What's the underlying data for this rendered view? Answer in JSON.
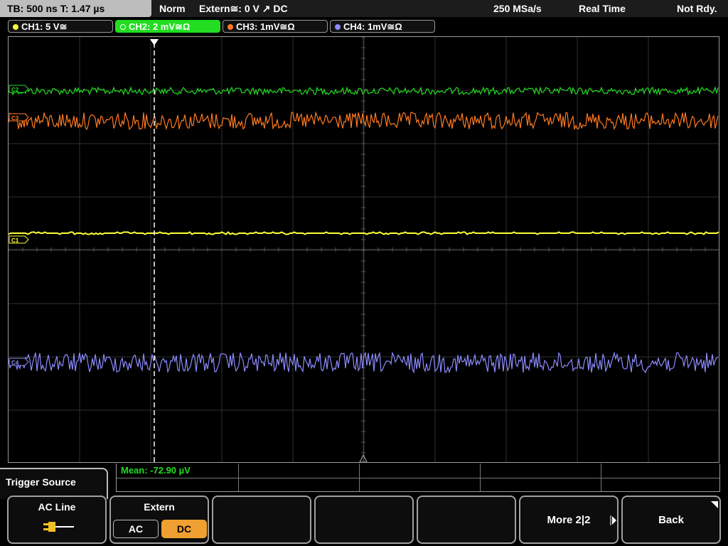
{
  "status": {
    "timebase": "TB: 500 ns   T: 1.47 µs",
    "trigger_mode": "Norm",
    "trigger_source_info": "Extern≅: 0 V ↗ DC",
    "sample_rate": "250 MSa/s",
    "acquisition": "Real Time",
    "state": "Not Rdy."
  },
  "channels": [
    {
      "label": "CH1: 5 V≅",
      "color": "#ffff33"
    },
    {
      "label": "CH2: 2 mV≅Ω",
      "color": "#22dd22"
    },
    {
      "label": "CH3: 1mV≅Ω",
      "color": "#ff7a20"
    },
    {
      "label": "CH4: 1mV≅Ω",
      "color": "#8c8cff"
    }
  ],
  "markers": {
    "ch2": "C2",
    "ch3": "C3",
    "ch1": "C1",
    "ch4": "C4"
  },
  "measurement": {
    "mean": "Mean: -72.90 µV"
  },
  "softkeys": {
    "panel_title": "Trigger Source",
    "ac_line": "AC Line",
    "extern": "Extern",
    "extern_ac": "AC",
    "extern_dc": "DC",
    "more": "More 2|2",
    "back": "Back"
  },
  "colors": {
    "ch1": "#ffff33",
    "ch2": "#22dd22",
    "ch3": "#ff7a20",
    "ch4": "#8c8cff",
    "selected_option": "#f0a030"
  }
}
